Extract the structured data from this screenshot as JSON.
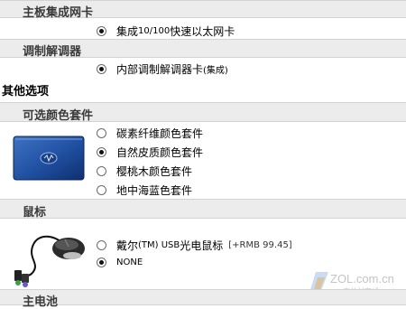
{
  "sections": {
    "nic": {
      "title": "主板集成网卡",
      "option": {
        "label_a": "集成 ",
        "label_b": "10/100",
        "label_c": " 快速以太网卡",
        "checked": true
      }
    },
    "modem": {
      "title": "调制解调器",
      "option": {
        "label_a": "内部调制解调器卡 ",
        "label_b": "(集成)",
        "checked": true
      }
    },
    "other": {
      "title": "其他选项"
    },
    "color_kit": {
      "title": "可选颜色套件",
      "options": [
        {
          "label": "碳素纤维颜色套件",
          "checked": false
        },
        {
          "label": "自然皮质颜色套件",
          "checked": true
        },
        {
          "label": "樱桃木颜色套件",
          "checked": false
        },
        {
          "label": "地中海蓝色套件",
          "checked": false
        }
      ]
    },
    "mouse": {
      "title": "鼠标",
      "options": [
        {
          "label_a": "戴尔",
          "label_b": "(TM) USB ",
          "label_c": "光电鼠标",
          "price": "[+RMB 99.45]",
          "checked": false
        },
        {
          "label": "NONE",
          "checked": true
        }
      ]
    },
    "battery": {
      "title": "主电池"
    }
  },
  "watermark": {
    "brand": "ZOL.com.cn",
    "tagline": "中关村在线"
  },
  "colors": {
    "header_bg": "#ececec",
    "lid_blue": "#1f4fa0"
  }
}
